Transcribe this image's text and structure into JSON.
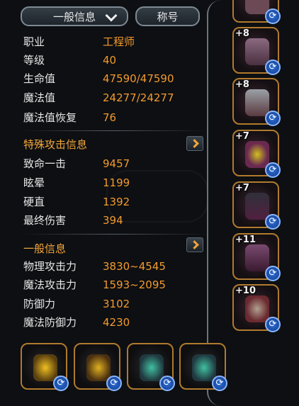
{
  "tabs": {
    "general_label": "一般信息",
    "title_label": "称号"
  },
  "basic_stats": [
    {
      "label": "职业",
      "value": "工程师"
    },
    {
      "label": "等级",
      "value": "40"
    },
    {
      "label": "生命值",
      "value": "47590/47590"
    },
    {
      "label": "魔法值",
      "value": "24277/24277"
    },
    {
      "label": "魔法值恢复",
      "value": "76"
    }
  ],
  "special_attack": {
    "header": "特殊攻击信息",
    "stats": [
      {
        "label": "致命一击",
        "value": "9457"
      },
      {
        "label": "眩晕",
        "value": "1199"
      },
      {
        "label": "硬直",
        "value": "1392"
      },
      {
        "label": "最终伤害",
        "value": "394"
      }
    ]
  },
  "general_info": {
    "header": "一般信息",
    "stats": [
      {
        "label": "物理攻击力",
        "value": "3830~4545"
      },
      {
        "label": "魔法攻击力",
        "value": "1593~2095"
      },
      {
        "label": "防御力",
        "value": "3102"
      },
      {
        "label": "魔法防御力",
        "value": "4230"
      }
    ]
  },
  "right_slots": [
    "",
    "+8",
    "+8",
    "+7",
    "+7",
    "+11",
    "+10"
  ],
  "colors": {
    "accent": "#f29a2e",
    "frame": "#b07a2e",
    "refresh": "#2d6fd8"
  }
}
